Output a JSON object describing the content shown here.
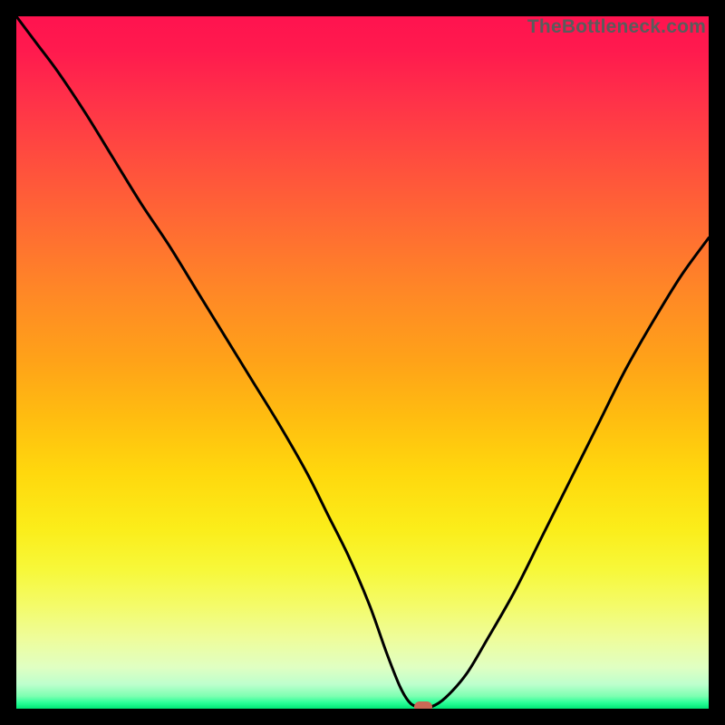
{
  "watermark": "TheBottleneck.com",
  "colors": {
    "frame": "#000000",
    "curve_stroke": "#000000",
    "marker": "#cb6956"
  },
  "chart_data": {
    "type": "line",
    "title": "",
    "xlabel": "",
    "ylabel": "",
    "xlim": [
      0,
      100
    ],
    "ylim": [
      0,
      100
    ],
    "series": [
      {
        "name": "bottleneck-curve",
        "x": [
          0,
          3,
          6,
          10,
          14,
          18,
          22,
          26,
          30,
          34,
          38,
          42,
          45,
          48,
          51,
          53.5,
          55.5,
          57,
          58.5,
          60,
          62,
          65,
          68,
          72,
          76,
          80,
          84,
          88,
          92,
          96,
          100
        ],
        "y": [
          100,
          96,
          92,
          86,
          79.5,
          73,
          67,
          60.5,
          54,
          47.5,
          41,
          34,
          28,
          22,
          15,
          8,
          3,
          0.7,
          0.3,
          0.3,
          1.6,
          5,
          10,
          17,
          25,
          33,
          41,
          49,
          56,
          62.5,
          68
        ]
      }
    ],
    "marker": {
      "x": 58.8,
      "y": 0.3
    }
  }
}
